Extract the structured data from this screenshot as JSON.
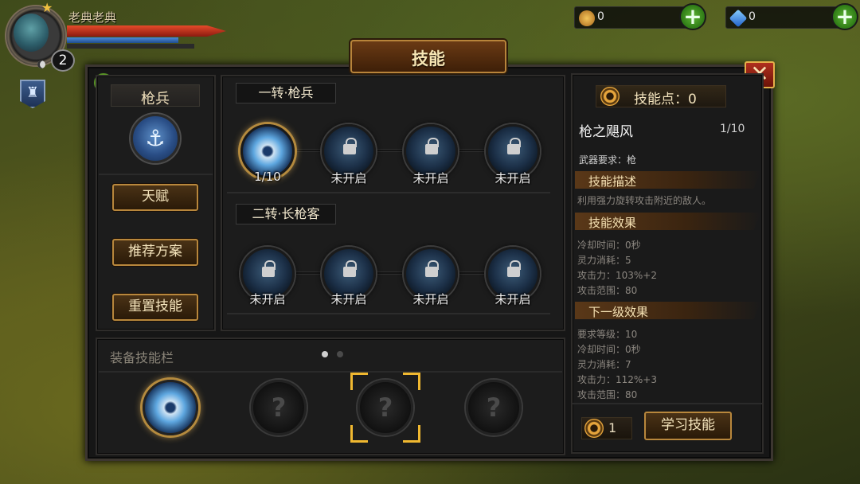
{
  "player": {
    "name": "老典老典",
    "level": "2"
  },
  "currency": [
    {
      "name": "gold",
      "value": "0",
      "icon": "coin-icon",
      "color": "#d89a30"
    },
    {
      "name": "diamond",
      "value": "0",
      "icon": "diamond-icon",
      "color": "#3c8ce6"
    }
  ],
  "window": {
    "title": "技能"
  },
  "left_panel": {
    "class_name": "枪兵",
    "buttons": [
      "天赋",
      "推荐方案",
      "重置技能"
    ]
  },
  "tree": {
    "tiers": [
      {
        "title": "一转·枪兵",
        "skills": [
          {
            "label": "1/10",
            "active": true
          },
          {
            "label": "未开启",
            "active": false
          },
          {
            "label": "未开启",
            "active": false
          },
          {
            "label": "未开启",
            "active": false
          }
        ]
      },
      {
        "title": "二转·长枪客",
        "skills": [
          {
            "label": "未开启",
            "active": false
          },
          {
            "label": "未开启",
            "active": false
          },
          {
            "label": "未开启",
            "active": false
          },
          {
            "label": "未开启",
            "active": false
          }
        ]
      }
    ]
  },
  "equip": {
    "title": "装备技能栏",
    "page": {
      "current": 1,
      "total": 2
    },
    "slots": [
      {
        "filled": true,
        "text": ""
      },
      {
        "filled": false,
        "text": "?"
      },
      {
        "filled": false,
        "text": "?",
        "selected": true
      },
      {
        "filled": false,
        "text": "?"
      }
    ]
  },
  "info": {
    "skill_points": "技能点：0",
    "skill_name": "枪之飓风",
    "skill_level": "1/10",
    "weapon_req": "武器要求：枪",
    "desc_title": "技能描述",
    "desc": "利用强力旋转攻击附近的敌人。",
    "effect_title": "技能效果",
    "effects": [
      "冷却时间：0秒",
      "灵力消耗：5",
      "攻击力：103%+2",
      "攻击范围：80"
    ],
    "next_title": "下一级效果",
    "next_effects": [
      "要求等级：10",
      "冷却时间：0秒",
      "灵力消耗：7",
      "攻击力：112%+3",
      "攻击范围：80"
    ],
    "cost": "1",
    "learn_label": "学习技能"
  },
  "colors": {
    "accent_gold": "#b8873c",
    "title_text": "#f7e6b4",
    "close_red": "#b0301e"
  }
}
